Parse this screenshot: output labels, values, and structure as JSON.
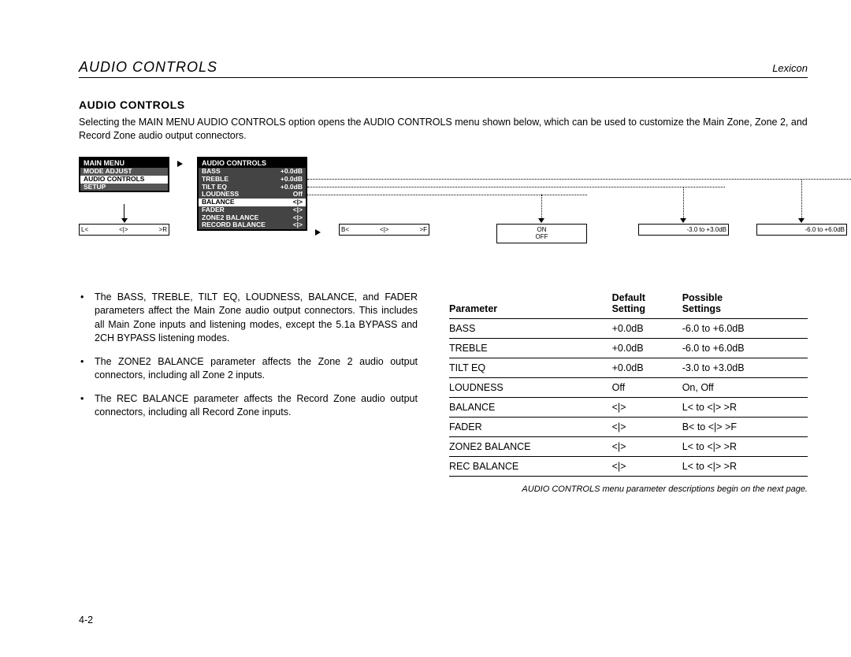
{
  "header": {
    "left": "AUDIO CONTROLS",
    "right": "Lexicon"
  },
  "section_title": "AUDIO CONTROLS",
  "intro": "Selecting the MAIN MENU AUDIO CONTROLS option opens the AUDIO CONTROLS menu shown below, which can be used to customize the Main Zone, Zone 2, and Record Zone audio output connectors.",
  "main_menu": {
    "title": "MAIN MENU",
    "items": [
      "MODE ADJUST",
      "AUDIO CONTROLS",
      "SETUP"
    ],
    "highlight_index": 1
  },
  "audio_menu": {
    "title": "AUDIO CONTROLS",
    "rows": [
      {
        "label": "BASS",
        "val": "+0.0dB"
      },
      {
        "label": "TREBLE",
        "val": "+0.0dB"
      },
      {
        "label": "TILT EQ",
        "val": "+0.0dB"
      },
      {
        "label": "LOUDNESS",
        "val": "Off"
      },
      {
        "label": "BALANCE",
        "val": "<|>"
      },
      {
        "label": "FADER",
        "val": "<|>"
      },
      {
        "label": "ZONE2 BALANCE",
        "val": "<|>"
      },
      {
        "label": "RECORD BALANCE",
        "val": "<|>"
      }
    ],
    "highlight_index": 4
  },
  "value_boxes": {
    "lr": {
      "l": "L<",
      "c": "<|>",
      "r": ">R"
    },
    "bf": {
      "l": "B<",
      "c": "<|>",
      "r": ">F"
    },
    "onoff": "ON\nOFF",
    "tilt": "-3.0 to +3.0dB",
    "bt": "-6.0 to +6.0dB"
  },
  "bullets": [
    "The BASS, TREBLE, TILT EQ, LOUDNESS, BALANCE, and FADER parameters affect the Main Zone audio output connectors. This includes all Main Zone inputs and listening modes, except the 5.1a BYPASS and 2CH BYPASS listening modes.",
    "The ZONE2 BALANCE parameter affects the Zone 2 audio output connectors, including all Zone 2 inputs.",
    "The REC BALANCE parameter affects the Record Zone audio output connectors, including all Record Zone inputs."
  ],
  "table": {
    "headers": {
      "param": "Parameter",
      "default": "Default\nSetting",
      "possible": "Possible\nSettings"
    },
    "rows": [
      {
        "param": "BASS",
        "default": "+0.0dB",
        "possible": "-6.0 to +6.0dB"
      },
      {
        "param": "TREBLE",
        "default": "+0.0dB",
        "possible": "-6.0 to +6.0dB"
      },
      {
        "param": "TILT EQ",
        "default": "+0.0dB",
        "possible": "-3.0 to +3.0dB"
      },
      {
        "param": "LOUDNESS",
        "default": "Off",
        "possible": "On, Off"
      },
      {
        "param": "BALANCE",
        "default": "<|>",
        "possible": "L< to <|> >R"
      },
      {
        "param": "FADER",
        "default": "<|>",
        "possible": "B< to <|> >F"
      },
      {
        "param": "ZONE2 BALANCE",
        "default": "<|>",
        "possible": "L< to <|> >R"
      },
      {
        "param": "REC BALANCE",
        "default": "<|>",
        "possible": "L< to <|> >R"
      }
    ]
  },
  "footnote": "AUDIO CONTROLS menu parameter descriptions begin on the next page.",
  "page_number": "4-2"
}
